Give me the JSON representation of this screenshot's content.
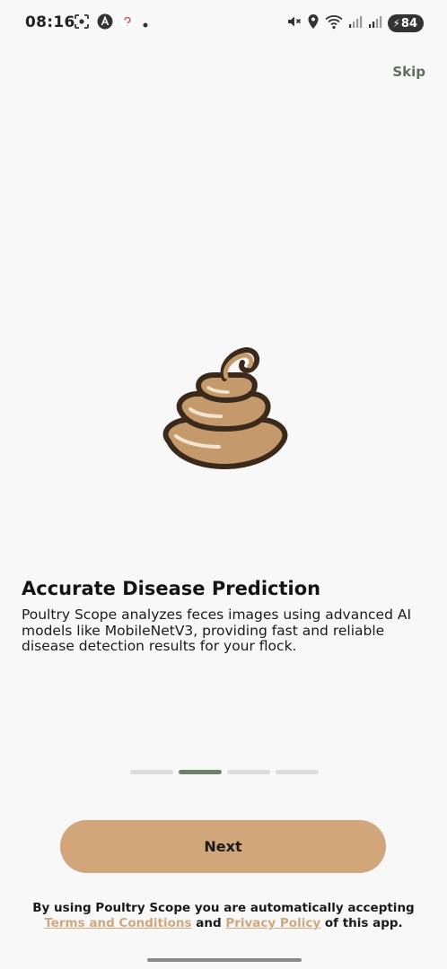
{
  "status_bar": {
    "time": "08:16",
    "battery_level": "84",
    "icons_left": [
      "screenshot-icon",
      "a-circle-icon",
      "app-notification-icon",
      "dot-icon"
    ],
    "icons_right": [
      "mute-icon",
      "location-icon",
      "wifi-icon",
      "signal-icon",
      "signal-icon",
      "battery-charging-icon"
    ]
  },
  "header": {
    "skip_label": "Skip"
  },
  "onboarding": {
    "illustration": "feces-icon",
    "title": "Accurate Disease Prediction",
    "description": "Poultry Scope analyzes feces images using advanced AI models like MobileNetV3, providing fast and reliable disease detection results for your flock.",
    "page_index": 2,
    "page_count": 4
  },
  "actions": {
    "next_label": "Next"
  },
  "legal": {
    "prefix": "By using Poultry Scope you are automatically accepting",
    "terms_label": "Terms and Conditions",
    "and": "and",
    "privacy_label": "Privacy Policy",
    "suffix": "of this app."
  },
  "colors": {
    "background": "#f8f8f8",
    "accent_tan": "#d1a67b",
    "skip_green": "#5e6e5c",
    "pager_active": "#6f7f6c",
    "pager_inactive": "#dcdcdc",
    "illustration_fill": "#c49a6c",
    "illustration_outline": "#3b2a1c"
  }
}
